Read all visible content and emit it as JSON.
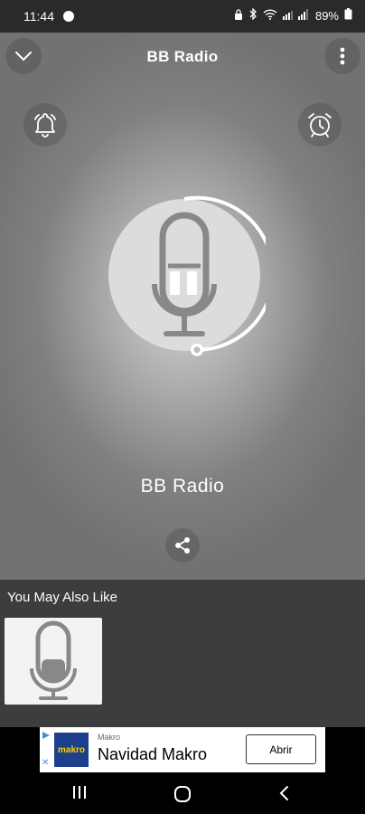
{
  "status_bar": {
    "time": "11:44",
    "battery": "89%",
    "icons": [
      "circle-icon",
      "lock-icon",
      "bluetooth-icon",
      "wifi-icon",
      "signal-icon",
      "battery-icon"
    ]
  },
  "header": {
    "title": "BB Radio",
    "collapse_icon": "chevron-down-icon",
    "menu_icon": "more-vertical-icon"
  },
  "controls": {
    "left_icon": "bell-icon",
    "right_icon": "alarm-clock-icon"
  },
  "player": {
    "station_name": "BB Radio",
    "artwork_icon": "microphone-icon",
    "state_icon": "pause-icon",
    "share_icon": "share-icon"
  },
  "recommendations": {
    "heading": "You May Also Like",
    "items": [
      {
        "icon": "microphone-icon"
      }
    ]
  },
  "ad": {
    "advertiser": "Makro",
    "logo_text": "makro",
    "title": "Navidad Makro",
    "cta": "Abrir"
  },
  "nav_bar": {
    "recents_icon": "recent-apps-icon",
    "home_icon": "home-icon",
    "back_icon": "back-icon"
  },
  "colors": {
    "player_bg_center": "#d6d6d6",
    "player_bg_edge": "#727272",
    "recommend_bg": "#3d3d3d",
    "ad_logo_bg": "#1d3f8c"
  }
}
